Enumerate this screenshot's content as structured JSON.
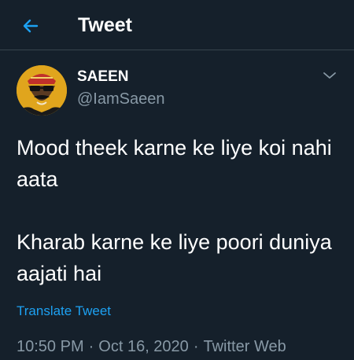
{
  "header": {
    "title": "Tweet",
    "back_icon": "arrow-left-icon"
  },
  "tweet": {
    "author": {
      "display_name": "SAEEN",
      "handle": "@IamSaeen"
    },
    "more_icon": "chevron-down-icon",
    "paragraphs": [
      "Mood theek karne ke liye koi nahi aata",
      "Kharab karne ke liye poori duniya aajati hai"
    ],
    "translate_label": "Translate Tweet",
    "time": "10:50 PM",
    "separator": "·",
    "date": "Oct 16, 2020",
    "source": "Twitter Web"
  },
  "colors": {
    "background": "#15202b",
    "accent": "#1da1f2",
    "secondary_text": "#8899a6",
    "divider": "#38444d"
  }
}
